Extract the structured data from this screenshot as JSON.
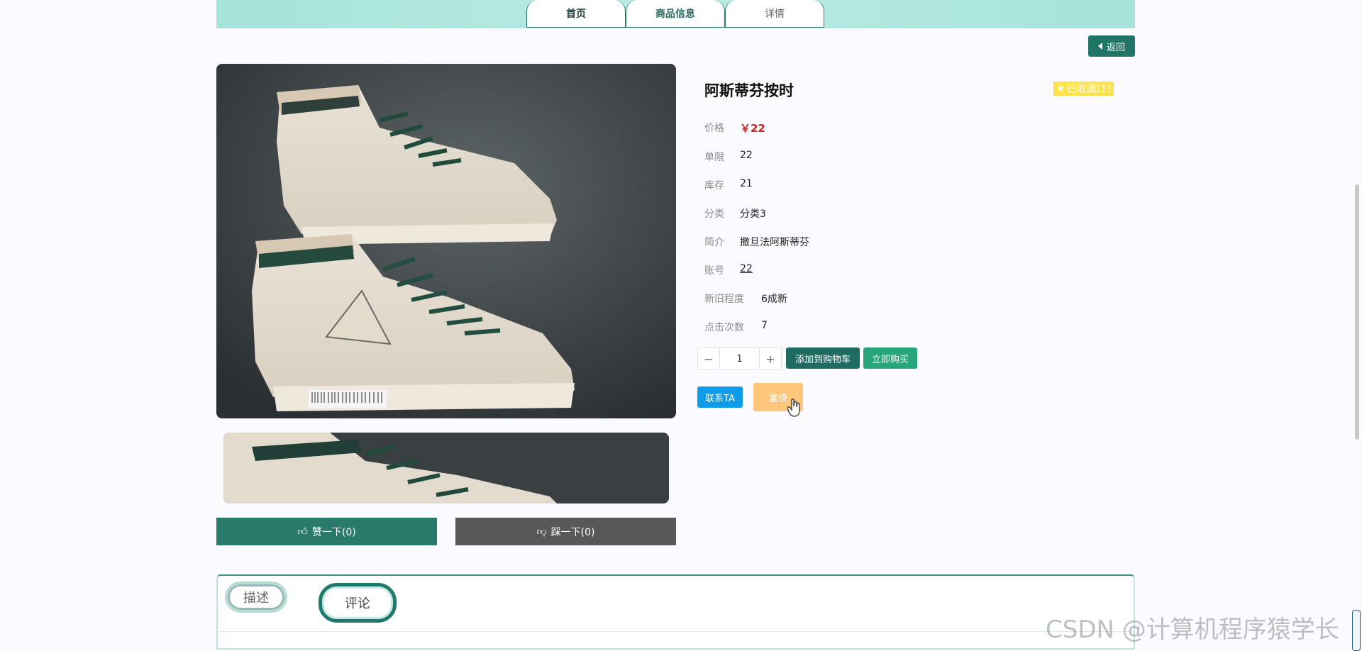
{
  "nav": {
    "tabs": [
      "首页",
      "商品信息",
      "详情"
    ]
  },
  "back_label": "返回",
  "product": {
    "title": "阿斯蒂芬按时",
    "favorite_label": "已收藏(1)",
    "fields": {
      "price_label": "价格",
      "price_value": "￥22",
      "limit_label": "单限",
      "limit_value": "22",
      "stock_label": "库存",
      "stock_value": "21",
      "category_label": "分类",
      "category_value": "分类3",
      "intro_label": "简介",
      "intro_value": "撒旦法阿斯蒂芬",
      "account_label": "账号",
      "account_value": "22",
      "condition_label": "新旧程度",
      "condition_value": "6成新",
      "clicks_label": "点击次数",
      "clicks_value": "7"
    },
    "quantity": "1",
    "add_to_cart": "添加到购物车",
    "buy_now": "立即购买",
    "contact": "联系TA",
    "swap": "置换"
  },
  "reactions": {
    "like": "赞一下(0)",
    "dislike": "踩一下(0)"
  },
  "detail_tabs": {
    "desc": "描述",
    "comment": "评论"
  },
  "watermark": "CSDN @计算机程序猿学长",
  "colors": {
    "accent": "#217566",
    "price": "#d21e1e",
    "buy": "#26a67a",
    "contact": "#0e9be8",
    "swap": "#ffc57a",
    "favorite": "#ffe24a"
  }
}
